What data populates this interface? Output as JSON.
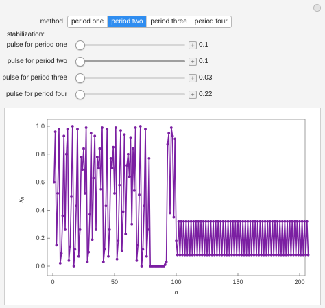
{
  "controls": {
    "method_label": "method",
    "method_options": [
      "period one",
      "period two",
      "period three",
      "period four"
    ],
    "method_selected": "period two",
    "stabilization_label": "stabilization:",
    "sliders": [
      {
        "label": "pulse for period one",
        "value": "0.1",
        "level": 0.0
      },
      {
        "label": "pulse for period two",
        "value": "0.1",
        "level": 0.0
      },
      {
        "label": "pulse for period three",
        "value": "0.03",
        "level": 0.0
      },
      {
        "label": "pulse for period four",
        "value": "0.22",
        "level": 0.0
      }
    ]
  },
  "colors": {
    "series": "#7b1fa2",
    "accent": "#2f8df0"
  },
  "chart_data": {
    "type": "line",
    "xlabel": "n",
    "ylabel": "x_n",
    "xlim": [
      0,
      200
    ],
    "ylim": [
      0,
      1.0
    ],
    "xticks": [
      "0",
      "50",
      "100",
      "150",
      "200"
    ],
    "yticks": [
      "0.0",
      "0.2",
      "0.4",
      "0.6",
      "0.8",
      "1.0"
    ],
    "series": [
      {
        "values": [
          0.6,
          0.96,
          0.15,
          0.52,
          0.98,
          0.02,
          0.09,
          0.36,
          0.93,
          0.26,
          0.8,
          0.98,
          0.04,
          0.14,
          0.5,
          1.0,
          0.0,
          0.12,
          0.43,
          0.98,
          0.07,
          0.26,
          0.78,
          0.69,
          0.84,
          0.52,
          0.99,
          0.03,
          0.1,
          0.37,
          0.95,
          0.19,
          0.63,
          0.93,
          0.26,
          0.78,
          0.7,
          0.84,
          0.55,
          0.99,
          0.03,
          0.12,
          0.43,
          0.98,
          0.07,
          0.26,
          0.77,
          0.7,
          0.85,
          0.52,
          0.99,
          0.05,
          0.18,
          0.58,
          0.97,
          0.11,
          0.39,
          0.94,
          0.23,
          0.72,
          0.8,
          0.64,
          0.92,
          0.3,
          0.84,
          0.54,
          0.99,
          0.04,
          0.15,
          0.51,
          1.0,
          0.0,
          0.12,
          0.43,
          0.98,
          0.07,
          0.26,
          0.77,
          0.0,
          0.0,
          0.0,
          0.0,
          0.0,
          0.0,
          0.0,
          0.0,
          0.0,
          0.0,
          0.0,
          0.0,
          0.01,
          0.03,
          0.87,
          0.95,
          0.38,
          0.99,
          0.93,
          0.35,
          0.91,
          0.18,
          0.08,
          0.32,
          0.08,
          0.32,
          0.08,
          0.32,
          0.08,
          0.32,
          0.08,
          0.32,
          0.08,
          0.32,
          0.08,
          0.32,
          0.08,
          0.32,
          0.08,
          0.32,
          0.08,
          0.32,
          0.08,
          0.32,
          0.08,
          0.32,
          0.08,
          0.32,
          0.08,
          0.32,
          0.08,
          0.32,
          0.08,
          0.32,
          0.08,
          0.32,
          0.08,
          0.32,
          0.08,
          0.32,
          0.08,
          0.32,
          0.08,
          0.32,
          0.08,
          0.32,
          0.08,
          0.32,
          0.08,
          0.32,
          0.08,
          0.32,
          0.08,
          0.32,
          0.08,
          0.32,
          0.08,
          0.32,
          0.08,
          0.32,
          0.08,
          0.32,
          0.08,
          0.32,
          0.08,
          0.32,
          0.08,
          0.32,
          0.08,
          0.32,
          0.08,
          0.32,
          0.08,
          0.32,
          0.08,
          0.32,
          0.08,
          0.32,
          0.08,
          0.32,
          0.08,
          0.32,
          0.08,
          0.32,
          0.08,
          0.32,
          0.08,
          0.32,
          0.08,
          0.32,
          0.08,
          0.32,
          0.08,
          0.32,
          0.08,
          0.32,
          0.08,
          0.32,
          0.08,
          0.32,
          0.08,
          0.32,
          0.08,
          0.32,
          0.08,
          0.32,
          0.08,
          0.32,
          0.08
        ]
      }
    ]
  }
}
